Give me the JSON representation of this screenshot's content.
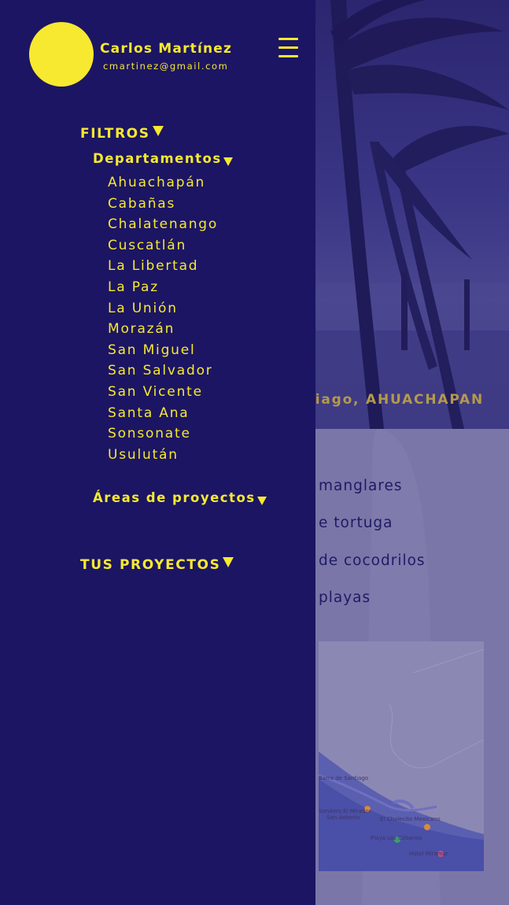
{
  "user": {
    "name": "Carlos Martínez",
    "email": "cmartinez@gmail.com"
  },
  "menu": {
    "icon": "hamburger-icon"
  },
  "filters": {
    "label": "FILTROS",
    "departments": {
      "label": "Departamentos",
      "items": [
        "Ahuachapán",
        "Cabañas",
        "Chalatenango",
        "Cuscatlán",
        "La Libertad",
        "La Paz",
        "La Unión",
        "Morazán",
        "San Miguel",
        "San Salvador",
        "San Vicente",
        "Santa Ana",
        "Sonsonate",
        "Usulután"
      ]
    },
    "project_areas": {
      "label": "Áreas de proyectos"
    }
  },
  "your_projects": {
    "label": "TUS PROYECTOS"
  },
  "background": {
    "hero_caption": "tiago, AHUACHAPAN",
    "areas": [
      "manglares",
      "e tortuga",
      "de cocodrilos",
      "playas"
    ],
    "map_labels": [
      "Barra de Santiago",
      "Sendero El Mirador",
      "San Antonio",
      "El Chalecito Mexicano",
      "Playa Los Cóbanos",
      "Hotel Miramar"
    ]
  },
  "colors": {
    "drawer_bg": "#1b1564",
    "accent": "#f7e92f",
    "overlay": "#7a76a8"
  }
}
